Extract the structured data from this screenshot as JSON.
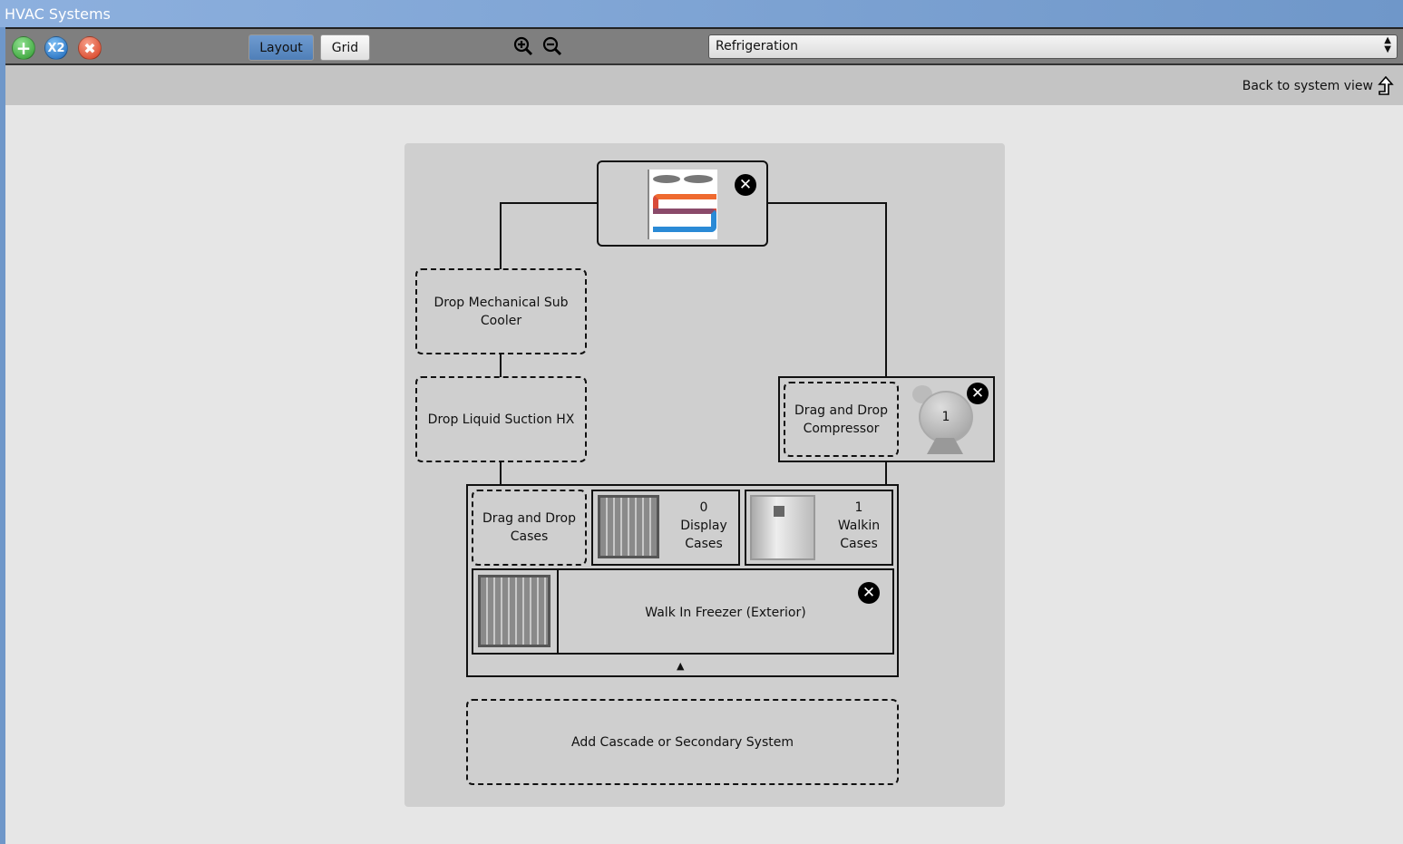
{
  "window": {
    "title": "HVAC Systems"
  },
  "toolbar": {
    "add_icon": "plus-icon",
    "duplicate_label": "X2",
    "delete_icon": "x-icon",
    "layout_label": "Layout",
    "grid_label": "Grid",
    "zoom_in": "zoom-in-icon",
    "zoom_out": "zoom-out-icon",
    "system_select": "Refrigeration",
    "colors": {
      "add": "#3faa3f",
      "duplicate": "#1f78c8",
      "delete": "#e0452a",
      "active_tab": "#5c89bf"
    }
  },
  "subbar": {
    "back_label": "Back to system view"
  },
  "diagram": {
    "sub_cooler": "Drop Mechanical Sub Cooler",
    "liquid_suction": "Drop Liquid Suction HX",
    "compressor_drop": "Drag and Drop Compressor",
    "compressor_count": "1",
    "cases_drop": "Drag and Drop Cases",
    "display_count": "0",
    "display_label": "Display Cases",
    "walkin_count": "1",
    "walkin_label": "Walkin Cases",
    "walkin_item": "Walk In Freezer (Exterior)",
    "cascade": "Add Cascade or Secondary System"
  }
}
